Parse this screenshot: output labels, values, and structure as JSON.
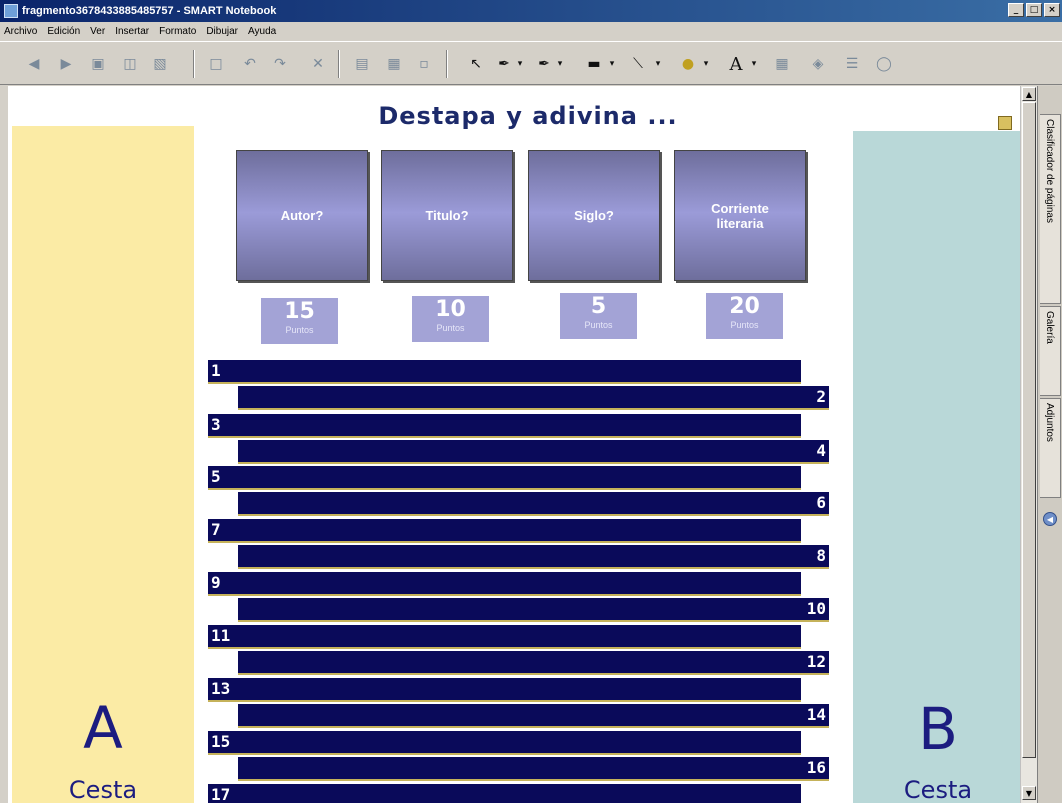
{
  "window": {
    "title": "fragmento3678433885485757 - SMART Notebook",
    "controls": [
      "_",
      "□",
      "×"
    ]
  },
  "menu": [
    "Archivo",
    "Edición",
    "Ver",
    "Insertar",
    "Formato",
    "Dibujar",
    "Ayuda"
  ],
  "toolbar": {
    "icons": [
      "page-previous-icon",
      "page-next-icon",
      "page-add-icon",
      "open-icon",
      "save-icon",
      "paste-icon",
      "undo-icon",
      "redo-icon",
      "delete-icon",
      "screen-shade-icon",
      "full-screen-icon",
      "dual-display-icon",
      "select-icon",
      "pen-icon",
      "creative-pen-icon",
      "eraser-icon",
      "line-icon",
      "magic-pen-icon",
      "text-icon",
      "table-icon",
      "fill-icon",
      "properties-icon",
      "more-icon"
    ]
  },
  "slide": {
    "title": "Destapa y adivina ...",
    "left_team": {
      "letter": "A",
      "label": "Cesta"
    },
    "right_team": {
      "letter": "B",
      "label": "Cesta"
    },
    "cards": [
      {
        "label": "Autor?",
        "points": "15",
        "points_label": "Puntos"
      },
      {
        "label": "Titulo?",
        "points": "10",
        "points_label": "Puntos"
      },
      {
        "label": "Siglo?",
        "points": "5",
        "points_label": "Puntos"
      },
      {
        "label": "Corriente\nliteraria",
        "points": "20",
        "points_label": "Puntos"
      }
    ],
    "bars": [
      "1",
      "2",
      "3",
      "4",
      "5",
      "6",
      "7",
      "8",
      "9",
      "10",
      "11",
      "12",
      "13",
      "14",
      "15",
      "16",
      "17"
    ]
  },
  "side_tabs": [
    "Clasificador de páginas",
    "Galería",
    "Adjuntos"
  ],
  "colors": {
    "bar": "#0a0a5a",
    "bar_border": "#c5b25a",
    "panel_a": "#fbeba5",
    "panel_b": "#b9d8d8",
    "card": "#9b9bd8",
    "points_box": "#a3a3d6",
    "title_text": "#1c2a6a"
  }
}
